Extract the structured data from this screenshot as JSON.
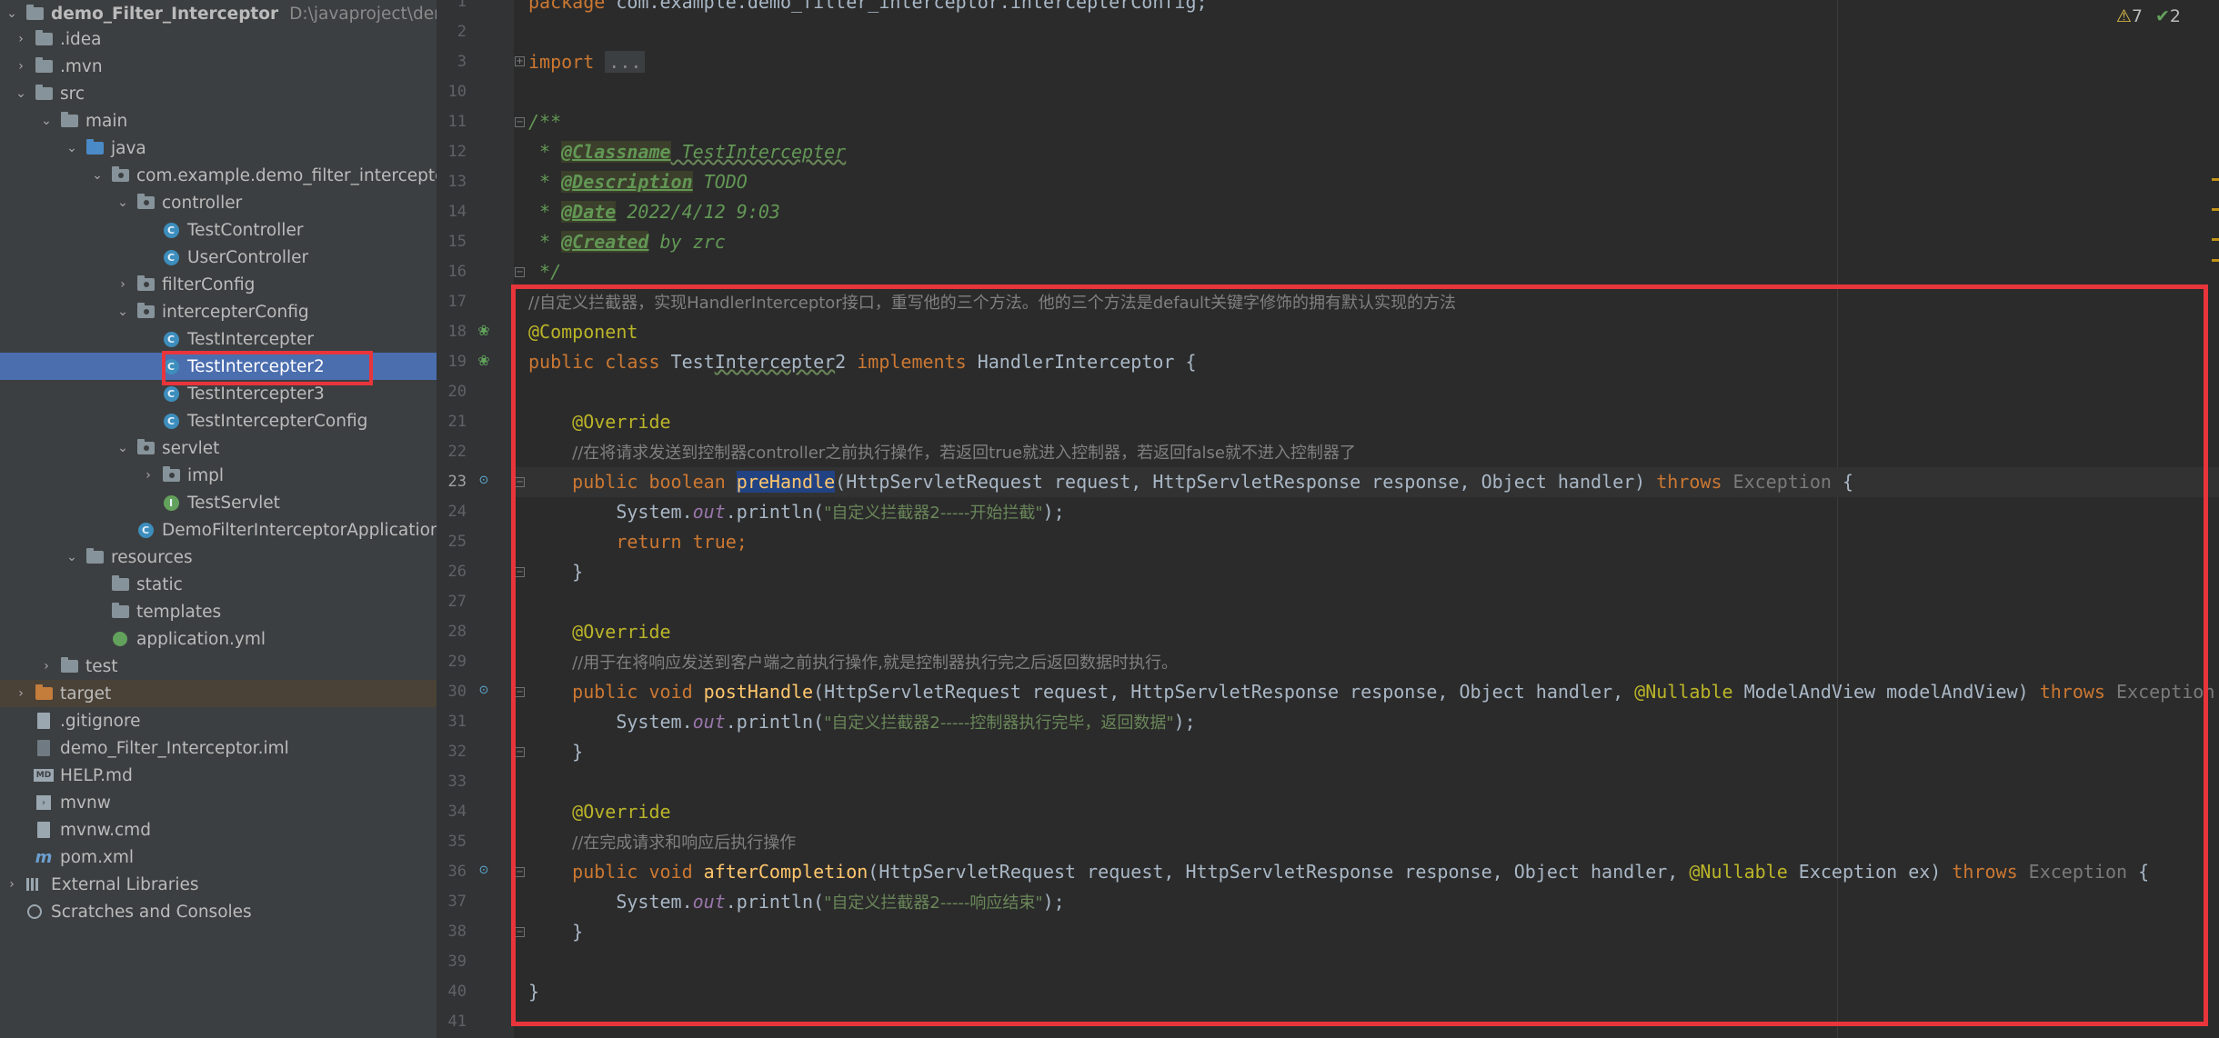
{
  "project_tree": {
    "root": {
      "name": "demo_Filter_Interceptor",
      "path": "D:\\javaproject\\demo_Filt"
    },
    "items": [
      {
        "label": ".idea"
      },
      {
        "label": ".mvn"
      },
      {
        "label": "src"
      },
      {
        "label": "main"
      },
      {
        "label": "java"
      },
      {
        "label": "com.example.demo_filter_interceptor"
      },
      {
        "label": "controller"
      },
      {
        "label": "TestController"
      },
      {
        "label": "UserController"
      },
      {
        "label": "filterConfig"
      },
      {
        "label": "intercepterConfig"
      },
      {
        "label": "TestIntercepter"
      },
      {
        "label": "TestIntercepter2"
      },
      {
        "label": "TestIntercepter3"
      },
      {
        "label": "TestIntercepterConfig"
      },
      {
        "label": "servlet"
      },
      {
        "label": "impl"
      },
      {
        "label": "TestServlet"
      },
      {
        "label": "DemoFilterInterceptorApplication"
      },
      {
        "label": "resources"
      },
      {
        "label": "static"
      },
      {
        "label": "templates"
      },
      {
        "label": "application.yml"
      },
      {
        "label": "test"
      },
      {
        "label": "target"
      },
      {
        "label": ".gitignore"
      },
      {
        "label": "demo_Filter_Interceptor.iml"
      },
      {
        "label": "HELP.md"
      },
      {
        "label": "mvnw"
      },
      {
        "label": "mvnw.cmd"
      },
      {
        "label": "pom.xml"
      },
      {
        "label": "External Libraries"
      },
      {
        "label": "Scratches and Consoles"
      }
    ]
  },
  "inspection": {
    "warnings": "7",
    "typos": "2"
  },
  "editor": {
    "line_numbers": [
      "1",
      "2",
      "3",
      "10",
      "11",
      "12",
      "13",
      "14",
      "15",
      "16",
      "17",
      "18",
      "19",
      "20",
      "21",
      "22",
      "23",
      "24",
      "25",
      "26",
      "27",
      "28",
      "29",
      "30",
      "31",
      "32",
      "33",
      "34",
      "35",
      "36",
      "37",
      "38",
      "39",
      "40",
      "41"
    ],
    "code": {
      "l1_kw": "package",
      "l1_rest": " com.example.demo_filter_interceptor.intercepterConfig;",
      "l3_kw": "import",
      "l3_fold": "...",
      "l11": "/**",
      "l12_pre": " * ",
      "l12_tag": "@Classname",
      "l12_val": " TestIntercepter",
      "l13_tag": "@Description",
      "l13_val": " TODO",
      "l14_tag": "@Date",
      "l14_val": " 2022/4/12 9:03",
      "l15_tag": "@Created",
      "l15_val": " by zrc",
      "l16": " */",
      "l17": "//自定义拦截器，实现HandlerInterceptor接口，重写他的三个方法。他的三个方法是default关键字修饰的拥有默认实现的方法",
      "l18": "@Component",
      "l19_kw": "public class",
      "l19_name_a": " Test",
      "l19_name_b": "Intercepter",
      "l19_name_c": "2 ",
      "l19_kw2": "implements",
      "l19_rest": " HandlerInterceptor {",
      "override": "@Override",
      "l22": "//在将请求发送到控制器controller之前执行操作，若返回true就进入控制器，若返回false就不进入控制器了",
      "l23_kw": "public boolean",
      "l23_fn": "preHandle",
      "l23_params": "(HttpServletRequest request, HttpServletResponse response, Object handler) ",
      "throws": "throws",
      "exception": " Exception",
      "brace_open": " {",
      "system": "System.",
      "out": "out",
      "println_open": ".println(",
      "l24_str": "\"自定义拦截器2-----开始拦截\"",
      "close_paren": ");",
      "l25_kw": "return true",
      "semicolon": ";",
      "close_brace": "}",
      "l29": "//用于在将响应发送到客户端之前执行操作,就是控制器执行完之后返回数据时执行。",
      "l30_kw": "public void",
      "l30_fn": "postHandle",
      "l30_params": "(HttpServletRequest request, HttpServletResponse response, Object handler, ",
      "nullable": "@Nullable",
      "l30_rest": " ModelAndView modelAndView) ",
      "l30_exc": " Exception",
      "l31_str": "\"自定义拦截器2-----控制器执行完毕，返回数据\"",
      "l35": "//在完成请求和响应后执行操作",
      "l36_fn": "afterCompletion",
      "l36_params": "(HttpServletRequest request, HttpServletResponse response, Object handler, ",
      "l36_rest": " Exception ex) ",
      "l37_str": "\"自定义拦截器2-----响应结束\"",
      "l40": "}"
    }
  }
}
